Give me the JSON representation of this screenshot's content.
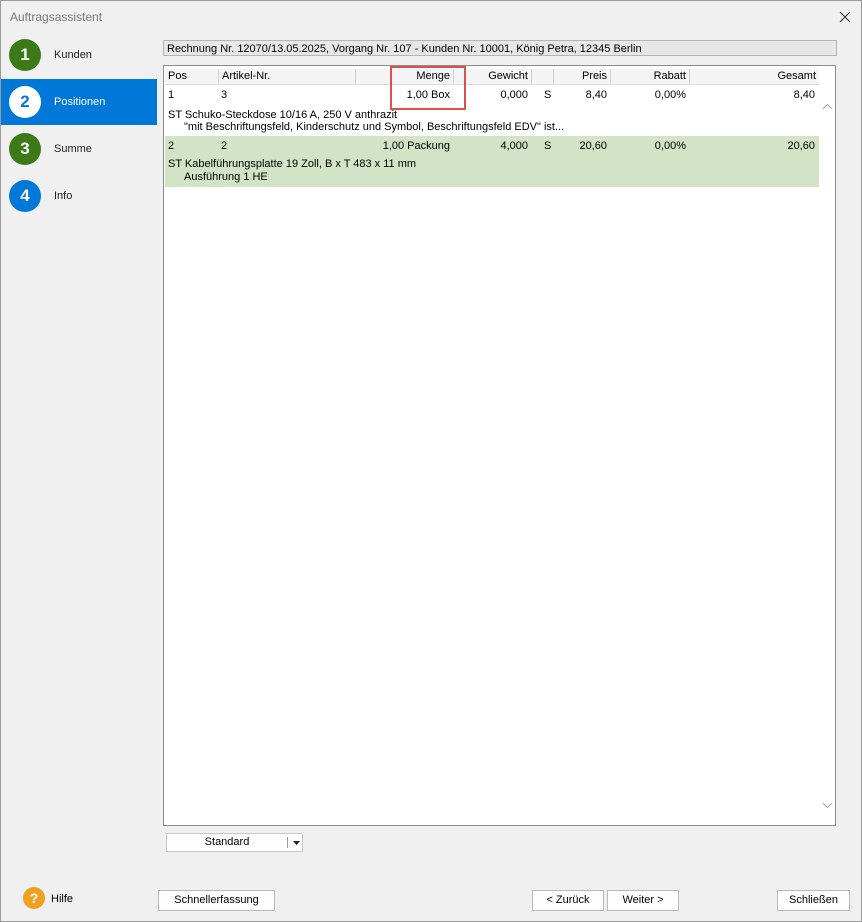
{
  "window": {
    "title": "Auftragsassistent"
  },
  "steps": [
    {
      "number": "1",
      "label": "Kunden",
      "color": "#3b7a17"
    },
    {
      "number": "2",
      "label": "Positionen",
      "color": "#0078d7"
    },
    {
      "number": "3",
      "label": "Summe",
      "color": "#3b7a17"
    },
    {
      "number": "4",
      "label": "Info",
      "color": "#0078d7"
    }
  ],
  "info": "Rechnung Nr. 12070/13.05.2025, Vorgang Nr. 107 - Kunden Nr. 10001, König Petra, 12345 Berlin",
  "grid": {
    "headers": [
      "Pos",
      "Artikel-Nr.",
      "Menge",
      "Gewicht",
      "",
      "Preis",
      "Rabatt",
      "Gesamt"
    ],
    "rows": [
      {
        "pos": "1",
        "artikel": "3",
        "menge": "1,00 Box",
        "gewicht": "0,000",
        "s": "S",
        "preis": "8,40",
        "rabatt": "0,00%",
        "gesamt": "8,40",
        "desc1": "ST Schuko-Steckdose 10/16 A, 250 V anthrazit",
        "desc2": "\"mit Beschriftungsfeld, Kinderschutz und Symbol, Beschriftungsfeld EDV\" ist..."
      },
      {
        "pos": "2",
        "artikel": "2",
        "menge": "1,00 Packung",
        "gewicht": "4,000",
        "s": "S",
        "preis": "20,60",
        "rabatt": "0,00%",
        "gesamt": "20,60",
        "desc1": "ST Kabelführungsplatte 19 Zoll, B x T 483 x 11 mm",
        "desc2": "Ausführung 1 HE"
      }
    ]
  },
  "view_select": "Standard",
  "buttons": {
    "help": "Hilfe",
    "quick_entry": "Schnellerfassung",
    "back": "< Zurück",
    "next": "Weiter >",
    "close": "Schließen"
  },
  "colors": {
    "accent": "#0078d7",
    "selected_row": "#d2e4c5",
    "highlight": "#e0504a"
  }
}
